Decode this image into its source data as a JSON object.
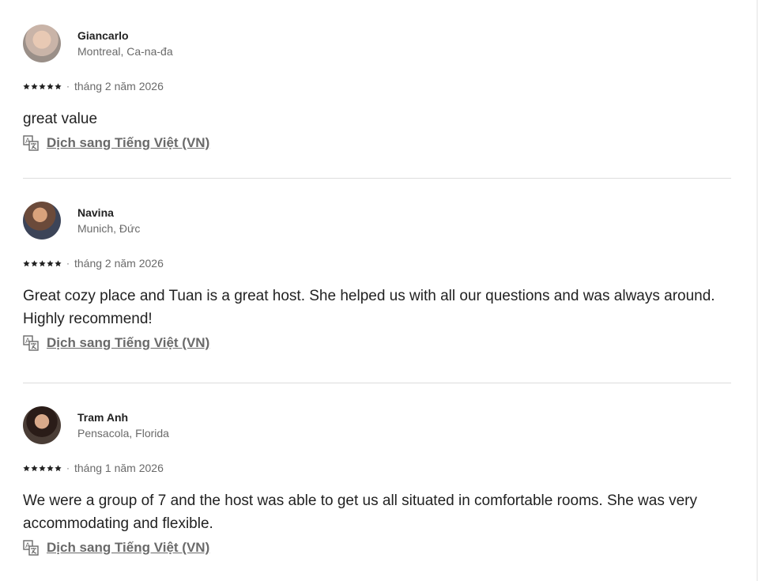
{
  "reviews": [
    {
      "name": "Giancarlo",
      "location": "Montreal, Ca-na-đa",
      "rating": 5,
      "date": "tháng 2 năm 2026",
      "text": "great value",
      "translate_label": "Dịch sang Tiếng Việt (VN)"
    },
    {
      "name": "Navina",
      "location": "Munich, Đức",
      "rating": 5,
      "date": "tháng 2 năm 2026",
      "text": "Great cozy place and Tuan is a great host. She helped us with all our questions and was always around. Highly recommend!",
      "translate_label": "Dịch sang Tiếng Việt (VN)"
    },
    {
      "name": "Tram Anh",
      "location": "Pensacola, Florida",
      "rating": 5,
      "date": "tháng 1 năm 2026",
      "text": "We were a group of 7 and the host was able to get us all situated in comfortable rooms. She was very accommodating and flexible.",
      "translate_label": "Dịch sang Tiếng Việt (VN)"
    }
  ],
  "separator": "·",
  "icons": {
    "star": "star-icon",
    "translate": "translate-icon"
  },
  "colors": {
    "text": "#222222",
    "muted": "#6a6a6a",
    "divider": "#dddddd"
  }
}
